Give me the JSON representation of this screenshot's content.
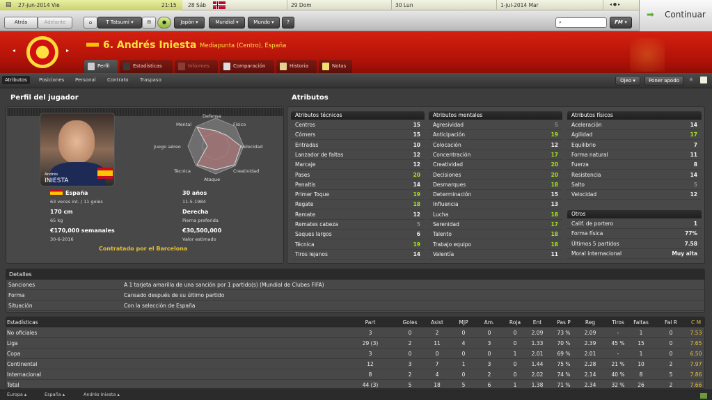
{
  "calendar": {
    "date": "27-jun-2014 Vie",
    "time": "21:15",
    "days": [
      "28 Sáb",
      "29 Dom",
      "30 Lun",
      "1-jul-2014 Mar"
    ]
  },
  "nav": {
    "back": "Atrás",
    "forward": "Adelante",
    "manager": "T Tatsumi",
    "japan": "Japón",
    "world_cup": "Mundial",
    "world": "Mundo",
    "fm": "FM",
    "continue": "Continuar"
  },
  "player": {
    "title": "6. Andrés Iniesta",
    "position": "Mediapunta (Centro), España",
    "card_first": "Andrés",
    "card_last": "INIESTA"
  },
  "tabs": [
    "Perfil",
    "Estadísticas",
    "Informes",
    "Comparación",
    "Historia",
    "Notas"
  ],
  "subtabs": [
    "Atributos",
    "Posiciones",
    "Personal",
    "Contrato",
    "Traspaso"
  ],
  "right_buttons": {
    "scout": "Ojeo",
    "nickname": "Poner apodo"
  },
  "profile": {
    "title": "Perfil del jugador",
    "radar": [
      "Defensa",
      "Físico",
      "Velocidad",
      "Creatividad",
      "Ataque",
      "Técnica",
      "Juego aéreo",
      "Mental"
    ],
    "nation": "España",
    "caps": "63 veces int. / 11 goles",
    "age": "30 años",
    "dob": "11-5-1984",
    "height": "170 cm",
    "weight": "65 kg",
    "foot": "Derecha",
    "foot_label": "Pierna preferida",
    "wage": "€170,000 semanales",
    "contract_end": "30-6-2016",
    "value": "€30,500,000",
    "value_label": "Valor estimado",
    "contracted": "Contratado por el Barcelona"
  },
  "attributes": {
    "title": "Atributos",
    "technical_title": "Atributos técnicos",
    "technical": [
      {
        "n": "Centros",
        "v": "15"
      },
      {
        "n": "Córners",
        "v": "15"
      },
      {
        "n": "Entradas",
        "v": "10"
      },
      {
        "n": "Lanzador de faltas",
        "v": "12"
      },
      {
        "n": "Marcaje",
        "v": "12"
      },
      {
        "n": "Pases",
        "v": "20"
      },
      {
        "n": "Penaltis",
        "v": "14"
      },
      {
        "n": "Primer Toque",
        "v": "19"
      },
      {
        "n": "Regate",
        "v": "18"
      },
      {
        "n": "Remate",
        "v": "12"
      },
      {
        "n": "Remates cabeza",
        "v": "5"
      },
      {
        "n": "Saques largos",
        "v": "6"
      },
      {
        "n": "Técnica",
        "v": "19"
      },
      {
        "n": "Tiros lejanos",
        "v": "14"
      }
    ],
    "mental_title": "Atributos mentales",
    "mental": [
      {
        "n": "Agresividad",
        "v": "5"
      },
      {
        "n": "Anticipación",
        "v": "19"
      },
      {
        "n": "Colocación",
        "v": "12"
      },
      {
        "n": "Concentración",
        "v": "17"
      },
      {
        "n": "Creatividad",
        "v": "20"
      },
      {
        "n": "Decisiones",
        "v": "20"
      },
      {
        "n": "Desmarques",
        "v": "18"
      },
      {
        "n": "Determinación",
        "v": "15"
      },
      {
        "n": "Influencia",
        "v": "13"
      },
      {
        "n": "Lucha",
        "v": "18"
      },
      {
        "n": "Serenidad",
        "v": "17"
      },
      {
        "n": "Talento",
        "v": "18"
      },
      {
        "n": "Trabajo equipo",
        "v": "18"
      },
      {
        "n": "Valentía",
        "v": "11"
      }
    ],
    "physical_title": "Atributos físicos",
    "physical": [
      {
        "n": "Aceleración",
        "v": "14"
      },
      {
        "n": "Agilidad",
        "v": "17"
      },
      {
        "n": "Equilibrio",
        "v": "7"
      },
      {
        "n": "Forma natural",
        "v": "11"
      },
      {
        "n": "Fuerza",
        "v": "8"
      },
      {
        "n": "Resistencia",
        "v": "14"
      },
      {
        "n": "Salto",
        "v": "5"
      },
      {
        "n": "Velocidad",
        "v": "12"
      }
    ],
    "other_title": "Otros",
    "other": [
      {
        "n": "Calif. de portero",
        "v": "1"
      },
      {
        "n": "Forma física",
        "v": "77%"
      },
      {
        "n": "Últimos 5 partidos",
        "v": "7.58"
      },
      {
        "n": "Moral internacional",
        "v": "Muy alta"
      }
    ]
  },
  "details": {
    "title": "Detalles",
    "rows": [
      {
        "k": "Sanciones",
        "v": "A 1 tarjeta amarilla de una sanción por 1 partido(s) (Mundial de Clubes FIFA)"
      },
      {
        "k": "Forma",
        "v": "Cansado después de su último partido"
      },
      {
        "k": "Situación",
        "v": "Con la selección de España"
      }
    ]
  },
  "stats": {
    "headers": [
      "Estadísticas",
      "Part",
      "Goles",
      "Asist",
      "MJP",
      "Am.",
      "Roja",
      "Ent",
      "Pas P",
      "Reg",
      "Tiros",
      "Faltas",
      "Fal R",
      "C M"
    ],
    "rows": [
      [
        "No oficiales",
        "3",
        "0",
        "2",
        "0",
        "0",
        "0",
        "2.09",
        "73 %",
        "2.09",
        "-",
        "1",
        "0",
        "7.53"
      ],
      [
        "Liga",
        "29 (3)",
        "2",
        "11",
        "4",
        "3",
        "0",
        "1.33",
        "70 %",
        "2.39",
        "45 %",
        "15",
        "0",
        "7.65"
      ],
      [
        "Copa",
        "3",
        "0",
        "0",
        "0",
        "0",
        "1",
        "2.01",
        "69 %",
        "2.01",
        "-",
        "1",
        "0",
        "6.50"
      ],
      [
        "Continental",
        "12",
        "3",
        "7",
        "1",
        "3",
        "0",
        "1.44",
        "75 %",
        "2.28",
        "21 %",
        "10",
        "2",
        "7.97"
      ],
      [
        "Internacional",
        "8",
        "2",
        "4",
        "0",
        "2",
        "0",
        "2.02",
        "74 %",
        "2.14",
        "40 %",
        "8",
        "5",
        "7.86"
      ],
      [
        "Total",
        "44 (3)",
        "5",
        "18",
        "5",
        "6",
        "1",
        "1.38",
        "71 %",
        "2.34",
        "32 %",
        "26",
        "2",
        "7.66"
      ]
    ]
  },
  "footer": [
    "Europa",
    "España",
    "Andrés Iniesta"
  ]
}
